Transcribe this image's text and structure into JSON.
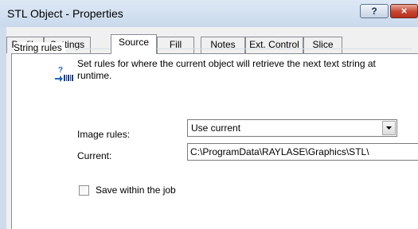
{
  "window": {
    "title": "STL Object - Properties",
    "help_label": "?",
    "close_label": "×"
  },
  "tabs": [
    {
      "label": "Profile"
    },
    {
      "label": "Settings"
    },
    {
      "label": "Source",
      "active": true
    },
    {
      "label": "Fill"
    },
    {
      "label": "Notes"
    },
    {
      "label": "Ext. Control"
    },
    {
      "label": "Slice"
    }
  ],
  "group": {
    "title": "String rules",
    "description": "Set rules for where the current object will retrieve the next text string at runtime."
  },
  "image_rules": {
    "label": "Image rules:",
    "selected": "Use current"
  },
  "current": {
    "label": "Current:",
    "value": "C:\\ProgramData\\RAYLASE\\Graphics\\STL\\"
  },
  "save_within_job": {
    "label": "Save within the job",
    "checked": false
  },
  "colors": {
    "title_bar": "#cfdceb",
    "close_button": "#c6432f",
    "panel": "#ffffff",
    "dialog": "#f0f0f0",
    "icon_blue": "#1e64c8"
  }
}
